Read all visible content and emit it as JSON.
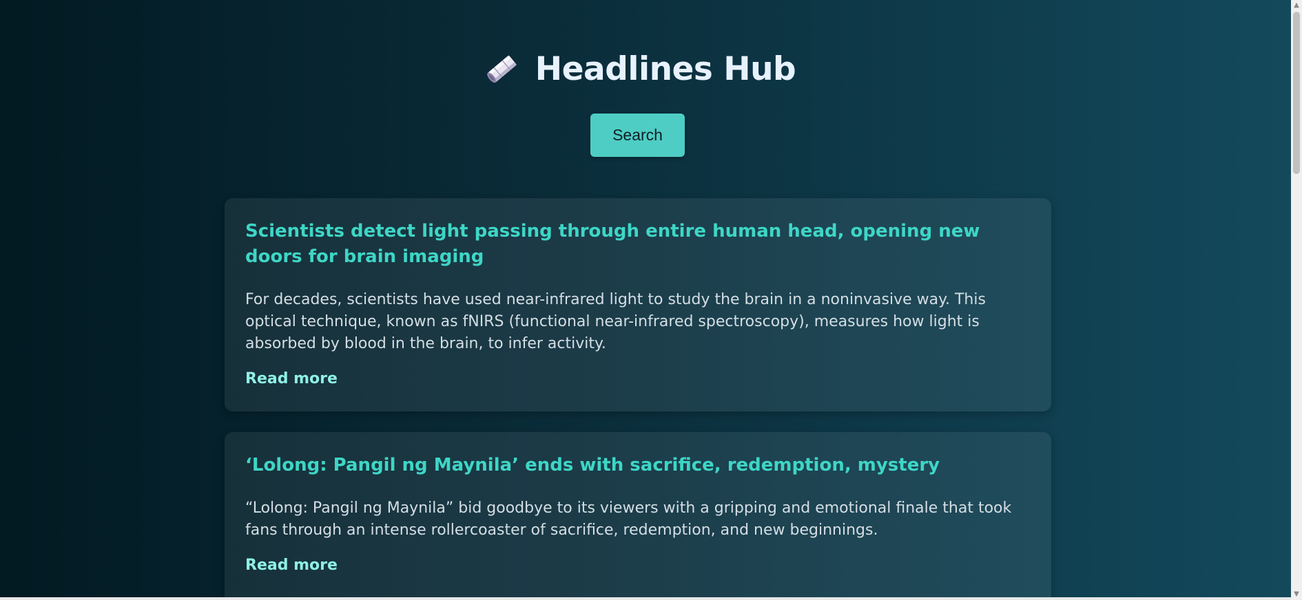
{
  "header": {
    "title": "Headlines Hub",
    "icon": "newspaper-roll-icon"
  },
  "search": {
    "button_label": "Search"
  },
  "articles": [
    {
      "title": "Scientists detect light passing through entire human head, opening new doors for brain imaging",
      "summary": "For decades, scientists have used near-infrared light to study the brain in a noninvasive way. This optical technique, known as fNIRS (functional near-infrared spectroscopy), measures how light is absorbed by blood in the brain, to infer activity.",
      "link_label": "Read more"
    },
    {
      "title": "‘Lolong: Pangil ng Maynila’ ends with sacrifice, redemption, mystery",
      "summary": "“Lolong: Pangil ng Maynila” bid goodbye to its viewers with a gripping and emotional finale that took fans through an intense rollercoaster of sacrifice, redemption, and new beginnings.",
      "link_label": "Read more"
    }
  ],
  "colors": {
    "accent": "#4ecdc4",
    "title_text": "#3ed6c6",
    "link_text": "#8ff0e4",
    "background_start": "#021a22",
    "background_end": "#134a5c"
  }
}
